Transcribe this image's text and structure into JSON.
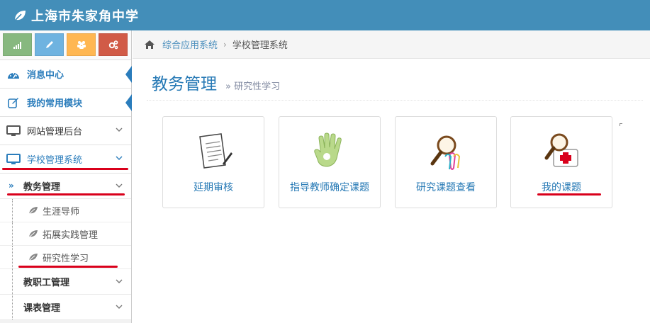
{
  "header": {
    "title": "上海市朱家角中学"
  },
  "shortcuts": [
    {
      "icon": "signal-icon",
      "color": "#87b87f"
    },
    {
      "icon": "pencil-icon",
      "color": "#6fb3e0"
    },
    {
      "icon": "users-icon",
      "color": "#ffb752"
    },
    {
      "icon": "cogs-icon",
      "color": "#d15b47"
    }
  ],
  "sidebar": {
    "items": [
      {
        "label": "消息中心",
        "icon": "dashboard-icon"
      },
      {
        "label": "我的常用模块",
        "icon": "edit-icon"
      },
      {
        "label": "网站管理后台",
        "icon": "desktop-icon"
      },
      {
        "label": "学校管理系统",
        "icon": "desktop-icon"
      }
    ],
    "sub": {
      "header": "教务管理",
      "leaves": [
        "生涯导师",
        "拓展实践管理",
        "研究性学习"
      ],
      "others": [
        "教职工管理",
        "课表管理"
      ]
    }
  },
  "breadcrumb": {
    "home": "综合应用系统",
    "current": "学校管理系统"
  },
  "page": {
    "title": "教务管理",
    "subtitle": "研究性学习",
    "subtitle_prefix": "»"
  },
  "cards": [
    {
      "label": "延期审核",
      "icon": "document-pen-icon"
    },
    {
      "label": "指导教师确定课题",
      "icon": "hand-icon"
    },
    {
      "label": "研究课题查看",
      "icon": "magnifier-clips-icon"
    },
    {
      "label": "我的课题",
      "icon": "magnifier-medkit-icon"
    }
  ],
  "colors": {
    "accent": "#438eb9",
    "link": "#2679b5",
    "annotation": "#d9001b"
  }
}
